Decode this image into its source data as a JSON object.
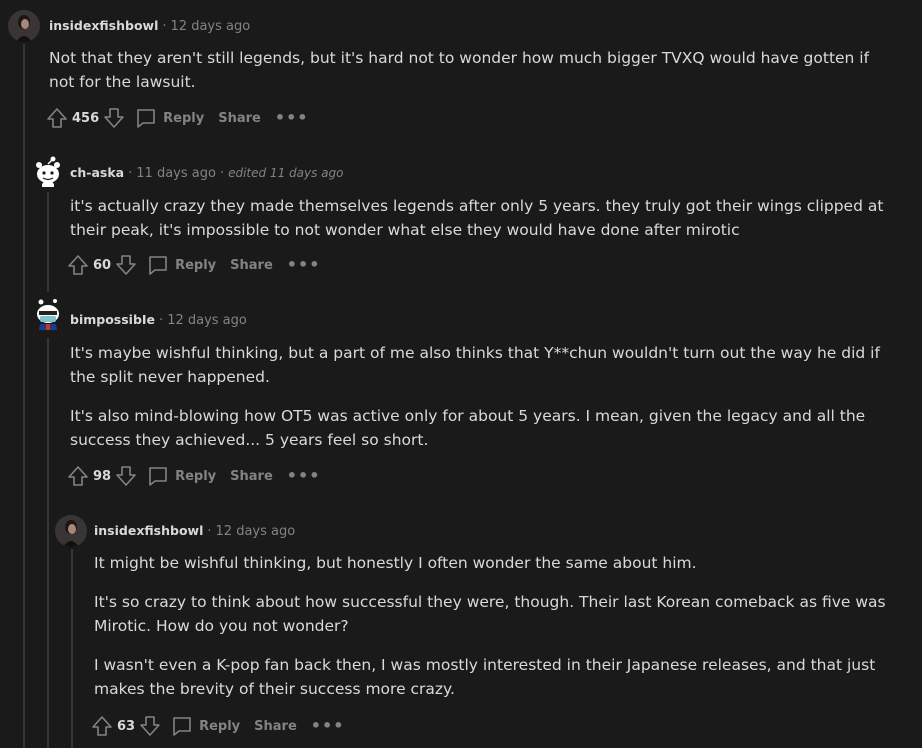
{
  "comments": [
    {
      "author": "insidexfishbowl",
      "time": "12 days ago",
      "body": [
        "Not that they aren't still legends, but it's hard not to wonder how much bigger TVXQ would have gotten if not for the lawsuit."
      ],
      "score": "456",
      "reply_label": "Reply",
      "share_label": "Share",
      "more_label": "•••"
    },
    {
      "author": "ch-aska",
      "time": "11 days ago",
      "edited": "edited 11 days ago",
      "body": [
        "it's actually crazy they made themselves legends after only 5 years. they truly got their wings clipped at their peak, it's impossible to not wonder what else they would have done after mirotic"
      ],
      "score": "60",
      "reply_label": "Reply",
      "share_label": "Share",
      "more_label": "•••"
    },
    {
      "author": "bimpossibIe",
      "time": "12 days ago",
      "body": [
        "It's maybe wishful thinking, but a part of me also thinks that Y**chun wouldn't turn out the way he did if the split never happened.",
        "It's also mind-blowing how OT5 was active only for about 5 years. I mean, given the legacy and all the success they achieved... 5 years feel so short."
      ],
      "score": "98",
      "reply_label": "Reply",
      "share_label": "Share",
      "more_label": "•••"
    },
    {
      "author": "insidexfishbowl",
      "time": "12 days ago",
      "body": [
        "It might be wishful thinking, but honestly I often wonder the same about him.",
        "It's so crazy to think about how successful they were, though. Their last Korean comeback as five was Mirotic. How do you not wonder?",
        "I wasn't even a K-pop fan back then, I was mostly interested in their Japanese releases, and that just makes the brevity of their success more crazy."
      ],
      "score": "63",
      "reply_label": "Reply",
      "share_label": "Share",
      "more_label": "•••"
    }
  ],
  "separator": "·",
  "icons": {
    "upvote": "upvote-arrow-icon",
    "downvote": "downvote-arrow-icon",
    "reply": "speech-bubble-icon",
    "more": "more-dots-icon"
  },
  "colors": {
    "background": "#1a1a1b",
    "text": "#d7dadc",
    "muted": "#818384",
    "thread_line": "#343536"
  }
}
